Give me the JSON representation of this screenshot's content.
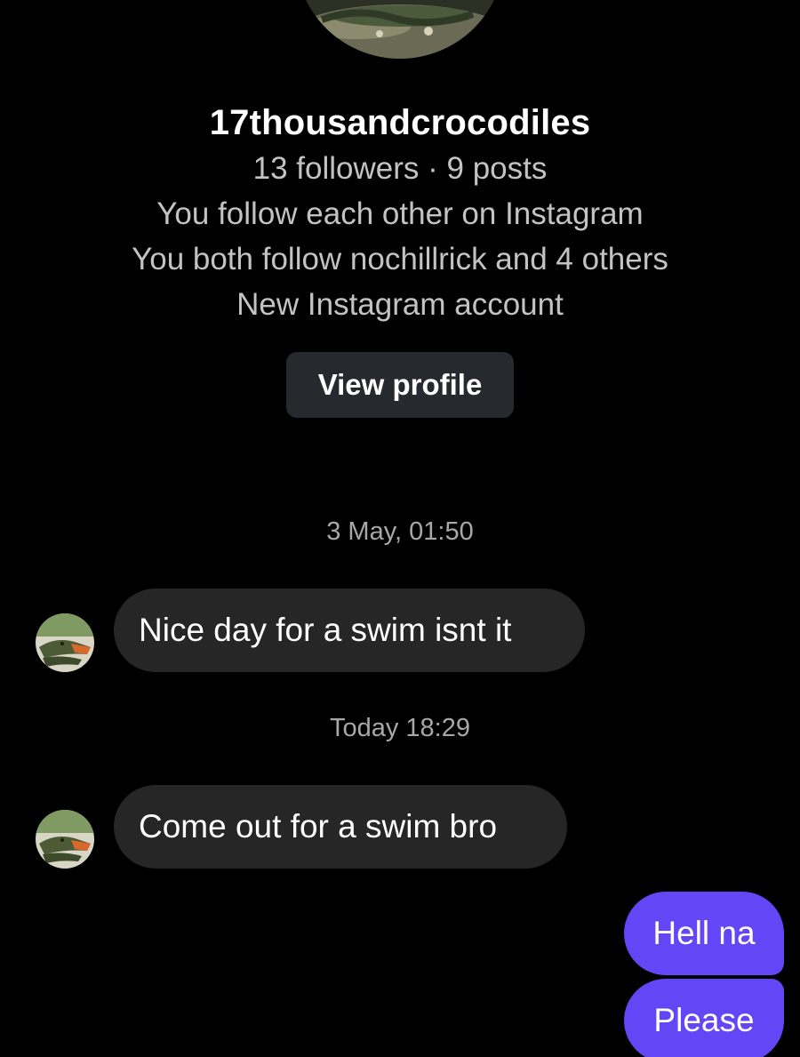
{
  "profile": {
    "username": "17thousandcrocodiles",
    "stats": "13 followers · 9 posts",
    "follow_status": "You follow each other on Instagram",
    "mutuals": "You both follow nochillrick and 4 others",
    "account_note": "New Instagram account",
    "view_profile_label": "View profile",
    "avatar_icon": "crocodile-avatar-icon"
  },
  "conversation": {
    "timestamps": [
      "3 May, 01:50",
      "Today 18:29"
    ],
    "incoming": [
      {
        "text": "Nice day for a swim isnt it"
      },
      {
        "text": "Come out for a swim bro"
      }
    ],
    "outgoing": [
      {
        "text": "Hell na"
      },
      {
        "text": "Please"
      }
    ]
  },
  "colors": {
    "background": "#000000",
    "incoming_bubble": "#262626",
    "outgoing_bubble": "#6346f5",
    "button": "#262a2f",
    "secondary_text": "#c3c3c3"
  }
}
